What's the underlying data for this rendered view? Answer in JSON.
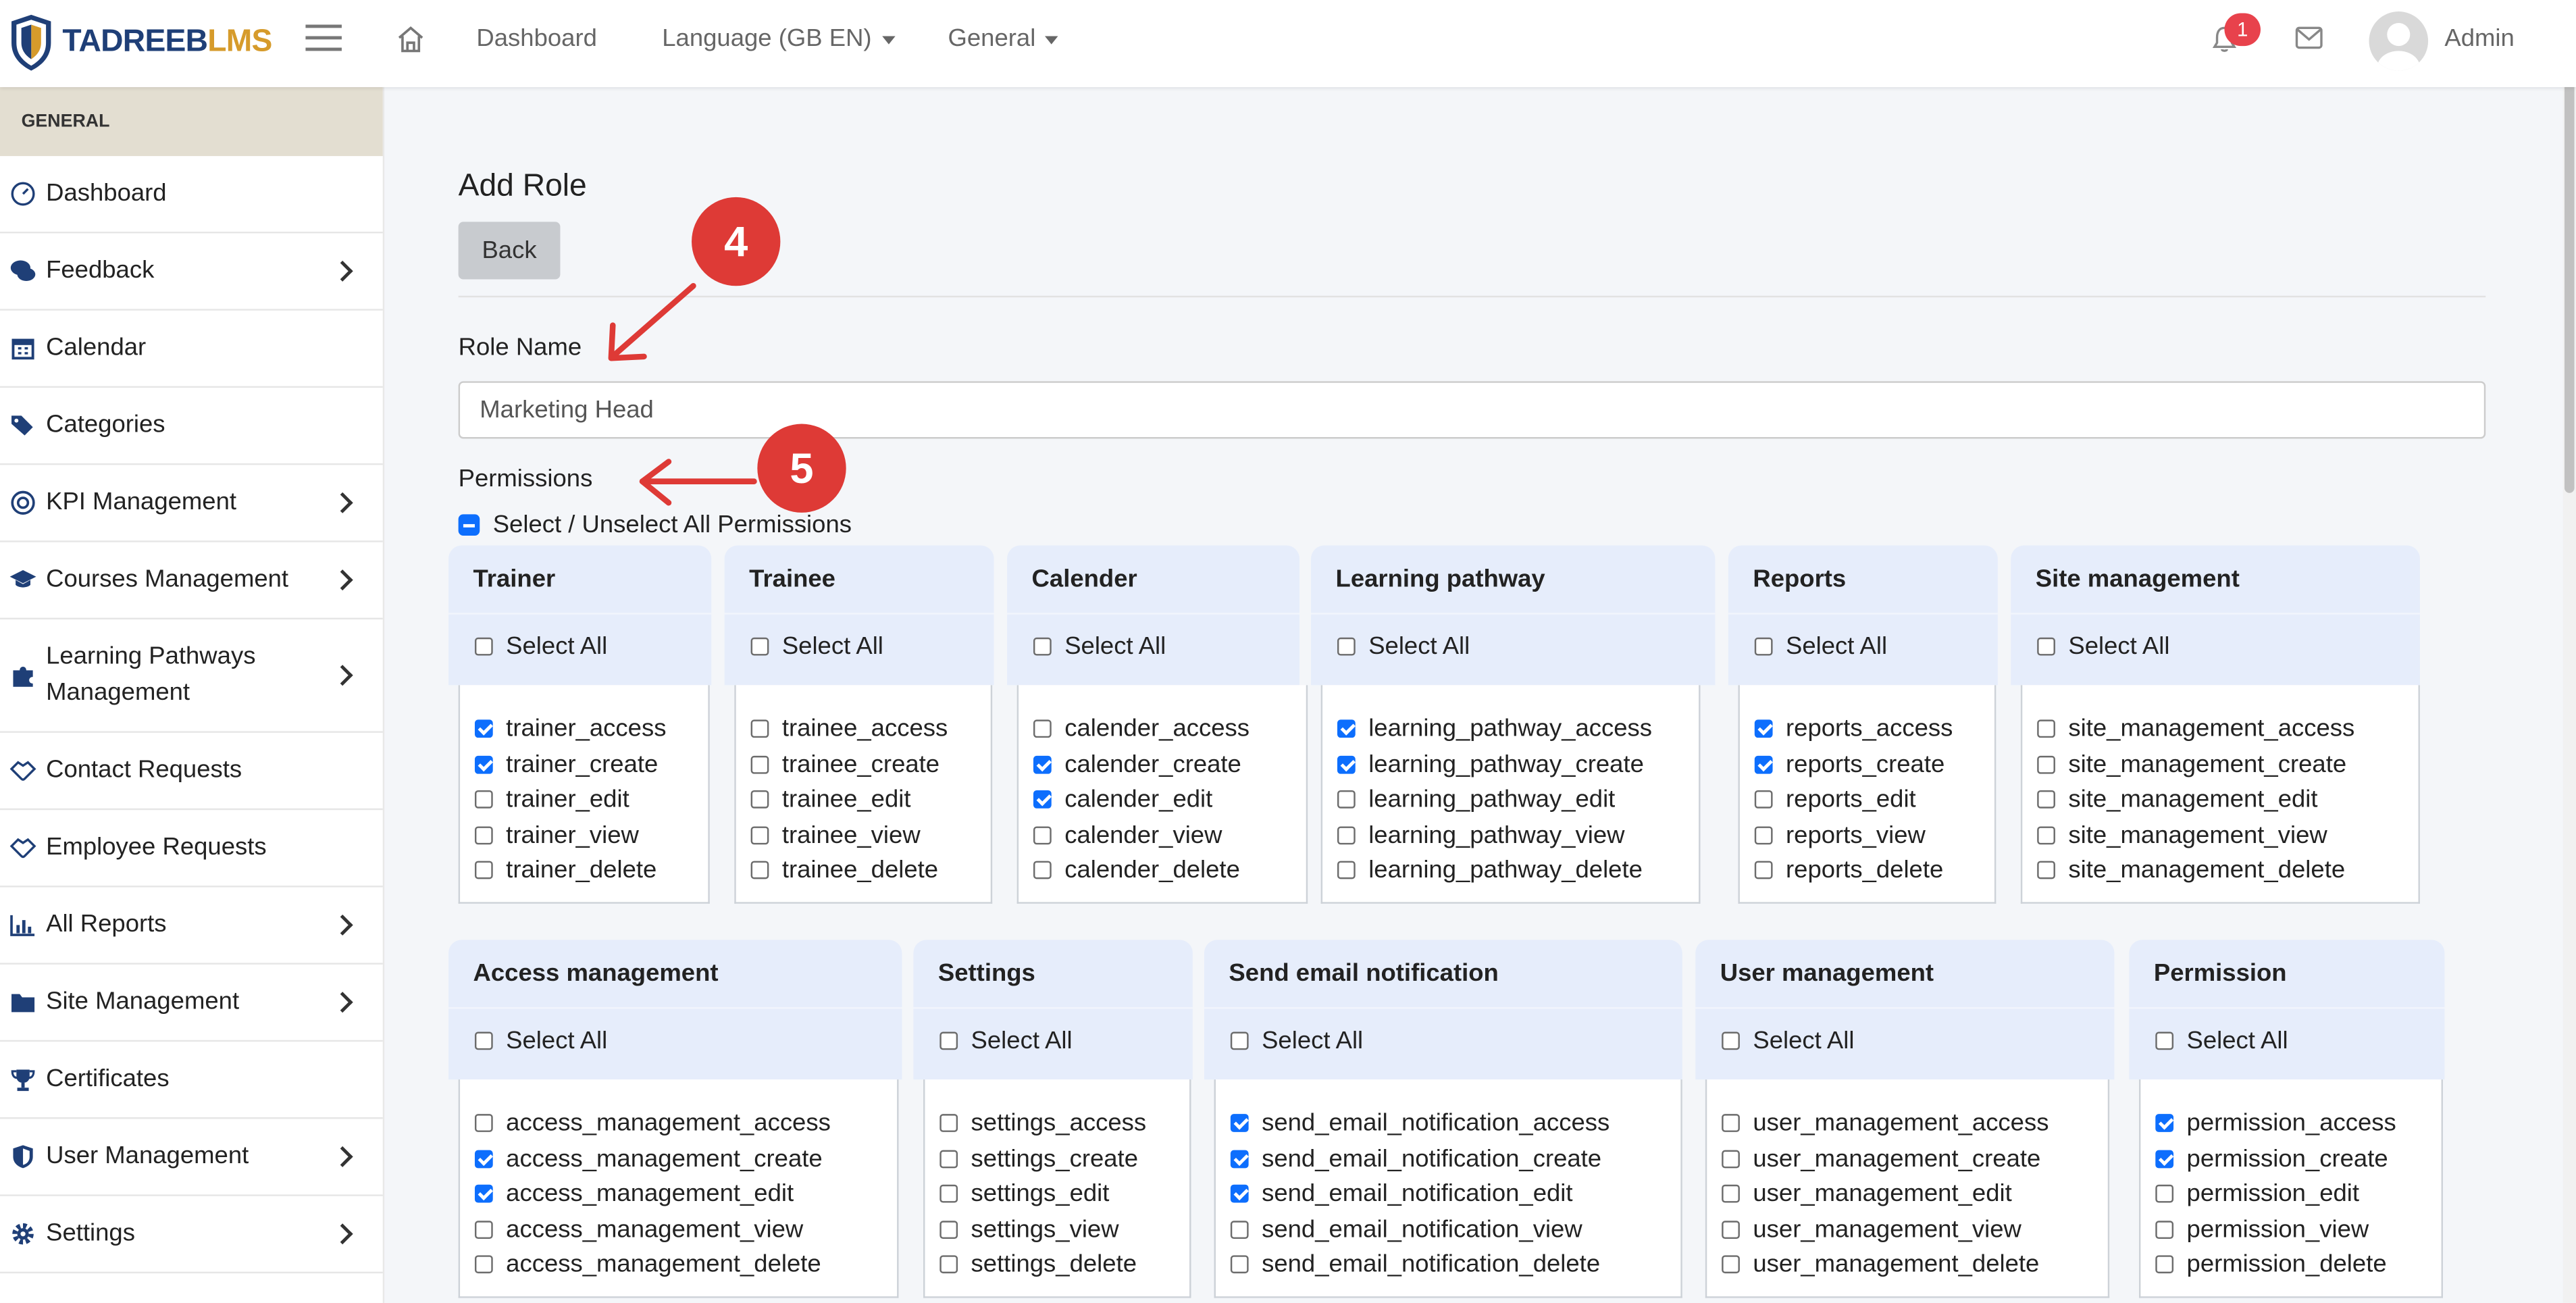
{
  "brand": {
    "logo_part1": "TADREEB",
    "logo_part2": "LMS"
  },
  "header": {
    "nav": {
      "dashboard": "Dashboard",
      "language": "Language (GB EN)",
      "general": "General"
    },
    "notification_count": "1",
    "user": "Admin"
  },
  "sidebar": {
    "section": "GENERAL",
    "items": [
      {
        "label": "Dashboard",
        "icon": "gauge-icon"
      },
      {
        "label": "Feedback",
        "icon": "comments-icon"
      },
      {
        "label": "Calendar",
        "icon": "calendar-icon"
      },
      {
        "label": "Categories",
        "icon": "tags-icon"
      },
      {
        "label": "KPI Management",
        "icon": "target-icon"
      },
      {
        "label": "Courses Management",
        "icon": "graduation-cap-icon"
      },
      {
        "label": "Learning Pathways Management",
        "icon": "puzzle-icon"
      },
      {
        "label": "Contact Requests",
        "icon": "handshake-icon"
      },
      {
        "label": "Employee Requests",
        "icon": "handshake-icon"
      },
      {
        "label": "All Reports",
        "icon": "bar-chart-icon"
      },
      {
        "label": "Site Management",
        "icon": "folder-icon"
      },
      {
        "label": "Certificates",
        "icon": "trophy-icon"
      },
      {
        "label": "User Management",
        "icon": "shield-icon"
      },
      {
        "label": "Settings",
        "icon": "gear-icon"
      }
    ]
  },
  "page": {
    "title": "Add Role",
    "back_label": "Back",
    "role_name_label": "Role Name",
    "role_name_value": "Marketing Head",
    "permissions_label": "Permissions",
    "select_unselect_all": "Select / Unselect All Permissions",
    "select_all_label": "Select All"
  },
  "annotations": {
    "marker_role": "4",
    "marker_permissions": "5"
  },
  "permission_groups": [
    {
      "title": "Trainer",
      "perms": [
        {
          "name": "trainer_access",
          "checked": true
        },
        {
          "name": "trainer_create",
          "checked": true
        },
        {
          "name": "trainer_edit",
          "checked": false
        },
        {
          "name": "trainer_view",
          "checked": false
        },
        {
          "name": "trainer_delete",
          "checked": false
        }
      ]
    },
    {
      "title": "Trainee",
      "perms": [
        {
          "name": "trainee_access",
          "checked": false
        },
        {
          "name": "trainee_create",
          "checked": false
        },
        {
          "name": "trainee_edit",
          "checked": false
        },
        {
          "name": "trainee_view",
          "checked": false
        },
        {
          "name": "trainee_delete",
          "checked": false
        }
      ]
    },
    {
      "title": "Calender",
      "perms": [
        {
          "name": "calender_access",
          "checked": false
        },
        {
          "name": "calender_create",
          "checked": true
        },
        {
          "name": "calender_edit",
          "checked": true
        },
        {
          "name": "calender_view",
          "checked": false
        },
        {
          "name": "calender_delete",
          "checked": false
        }
      ]
    },
    {
      "title": "Learning pathway",
      "perms": [
        {
          "name": "learning_pathway_access",
          "checked": true
        },
        {
          "name": "learning_pathway_create",
          "checked": true
        },
        {
          "name": "learning_pathway_edit",
          "checked": false
        },
        {
          "name": "learning_pathway_view",
          "checked": false
        },
        {
          "name": "learning_pathway_delete",
          "checked": false
        }
      ]
    },
    {
      "title": "Reports",
      "perms": [
        {
          "name": "reports_access",
          "checked": true
        },
        {
          "name": "reports_create",
          "checked": true
        },
        {
          "name": "reports_edit",
          "checked": false
        },
        {
          "name": "reports_view",
          "checked": false
        },
        {
          "name": "reports_delete",
          "checked": false
        }
      ]
    },
    {
      "title": "Site management",
      "perms": [
        {
          "name": "site_management_access",
          "checked": false
        },
        {
          "name": "site_management_create",
          "checked": false
        },
        {
          "name": "site_management_edit",
          "checked": false
        },
        {
          "name": "site_management_view",
          "checked": false
        },
        {
          "name": "site_management_delete",
          "checked": false
        }
      ]
    },
    {
      "title": "Access management",
      "perms": [
        {
          "name": "access_management_access",
          "checked": false
        },
        {
          "name": "access_management_create",
          "checked": true
        },
        {
          "name": "access_management_edit",
          "checked": true
        },
        {
          "name": "access_management_view",
          "checked": false
        },
        {
          "name": "access_management_delete",
          "checked": false
        }
      ]
    },
    {
      "title": "Settings",
      "perms": [
        {
          "name": "settings_access",
          "checked": false
        },
        {
          "name": "settings_create",
          "checked": false
        },
        {
          "name": "settings_edit",
          "checked": false
        },
        {
          "name": "settings_view",
          "checked": false
        },
        {
          "name": "settings_delete",
          "checked": false
        }
      ]
    },
    {
      "title": "Send email notification",
      "perms": [
        {
          "name": "send_email_notification_access",
          "checked": true
        },
        {
          "name": "send_email_notification_create",
          "checked": true
        },
        {
          "name": "send_email_notification_edit",
          "checked": true
        },
        {
          "name": "send_email_notification_view",
          "checked": false
        },
        {
          "name": "send_email_notification_delete",
          "checked": false
        }
      ]
    },
    {
      "title": "User management",
      "perms": [
        {
          "name": "user_management_access",
          "checked": false
        },
        {
          "name": "user_management_create",
          "checked": false
        },
        {
          "name": "user_management_edit",
          "checked": false
        },
        {
          "name": "user_management_view",
          "checked": false
        },
        {
          "name": "user_management_delete",
          "checked": false
        }
      ]
    },
    {
      "title": "Permission",
      "perms": [
        {
          "name": "permission_access",
          "checked": true
        },
        {
          "name": "permission_create",
          "checked": true
        },
        {
          "name": "permission_edit",
          "checked": false
        },
        {
          "name": "permission_view",
          "checked": false
        },
        {
          "name": "permission_delete",
          "checked": false
        }
      ]
    }
  ]
}
